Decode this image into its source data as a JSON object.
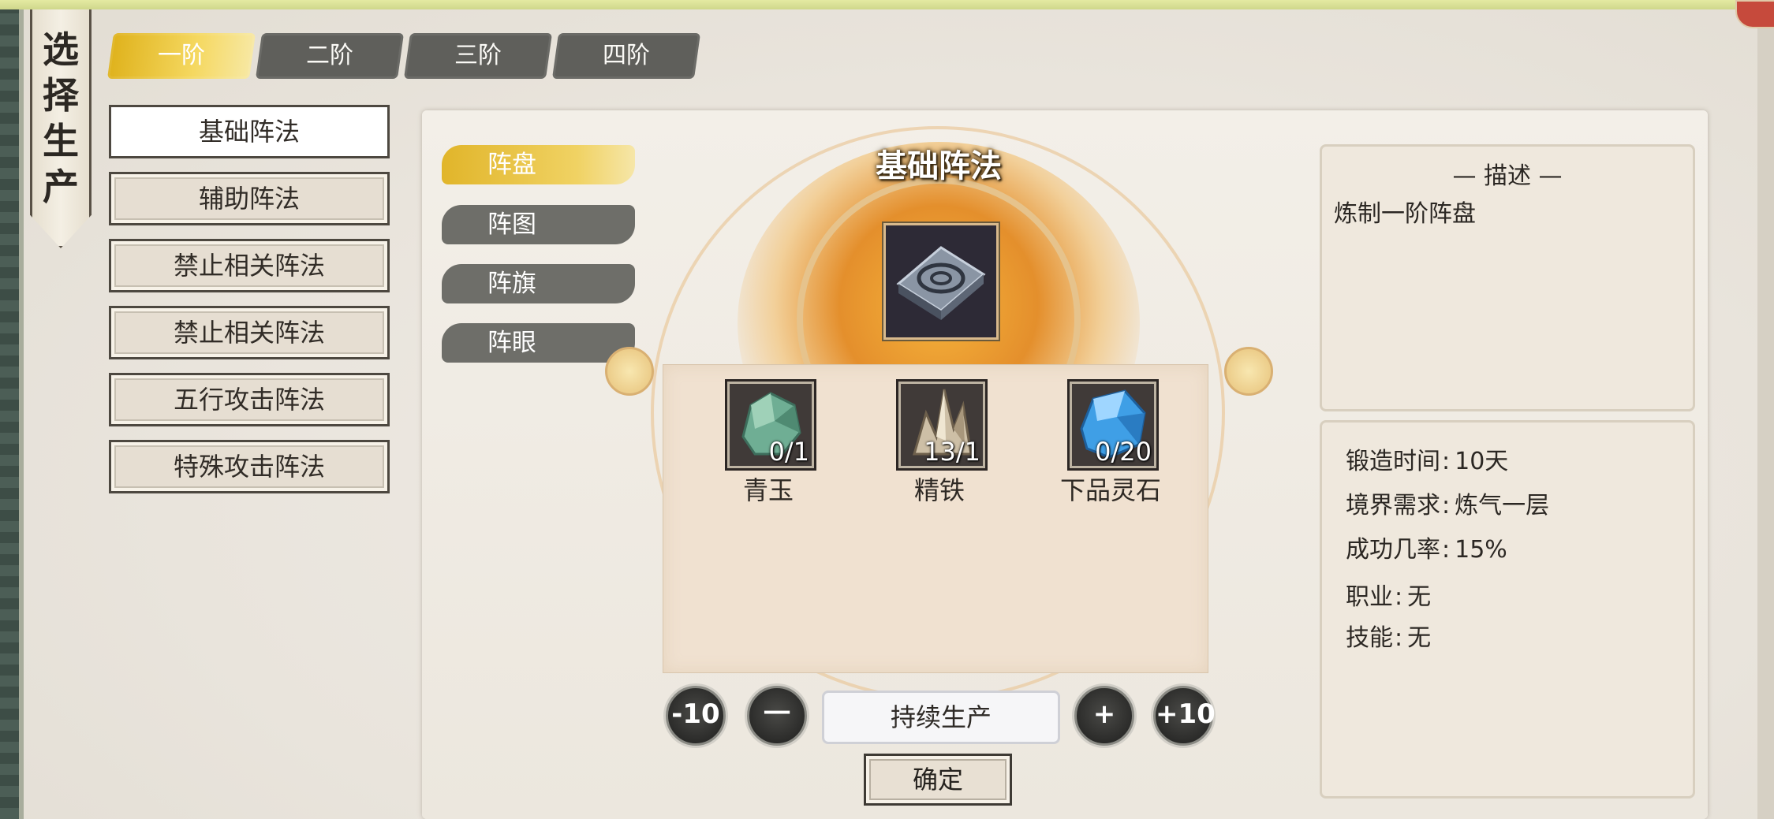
{
  "banner": {
    "title": "选择生产"
  },
  "tiers": [
    "一阶",
    "二阶",
    "三阶",
    "四阶"
  ],
  "categories": [
    "基础阵法",
    "辅助阵法",
    "禁止相关阵法",
    "禁止相关阵法",
    "五行攻击阵法",
    "特殊攻击阵法"
  ],
  "subtypes": [
    "阵盘",
    "阵图",
    "阵旗",
    "阵眼"
  ],
  "recipe": {
    "title": "基础阵法",
    "product_icon": "array-disc-icon",
    "materials": [
      {
        "name": "青玉",
        "count": "0/1",
        "icon": "jade-icon"
      },
      {
        "name": "精铁",
        "count": "13/1",
        "icon": "iron-ore-icon"
      },
      {
        "name": "下品灵石",
        "count": "0/20",
        "icon": "spirit-stone-icon"
      }
    ]
  },
  "controls": {
    "minus10": "-10",
    "minus": "一",
    "plus": "+",
    "plus10": "+10",
    "quantity_mode": "持续生产",
    "confirm": "确定"
  },
  "description": {
    "header": "— 描述 —",
    "text": "炼制一阶阵盘"
  },
  "stats": [
    {
      "label": "锻造时间",
      "value": "10天"
    },
    {
      "label": "境界需求",
      "value": "炼气一层"
    },
    {
      "label": "成功几率",
      "value": "15%"
    },
    {
      "label": "职业",
      "value": "无"
    },
    {
      "label": "技能",
      "value": "无"
    }
  ],
  "colors": {
    "accent_gold": "#e6ba2b",
    "tab_gray": "#5f5f5b",
    "close_red": "#c64a3c"
  }
}
